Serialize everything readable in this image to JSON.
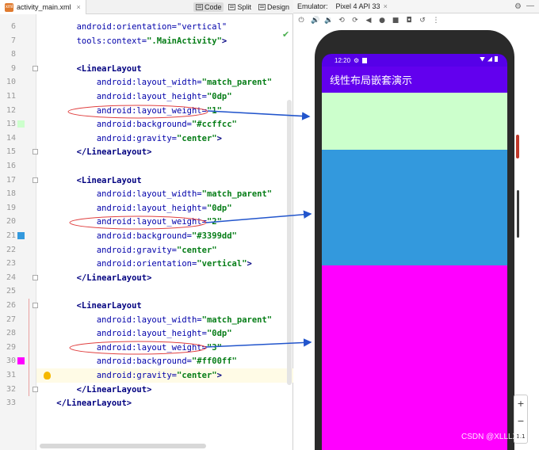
{
  "editor": {
    "file_tab": "activity_main.xml",
    "file_close": "×",
    "xml_badge": "xml",
    "view_modes": [
      "Code",
      "Split",
      "Design"
    ],
    "lines": [
      {
        "num": "6",
        "parts": [
          {
            "t": "attr",
            "v": "        android:orientation=\"vertical\""
          }
        ]
      },
      {
        "num": "7",
        "parts": [
          {
            "t": "attr",
            "v": "        tools:context="
          },
          {
            "t": "val",
            "v": "\".MainActivity\""
          },
          {
            "t": "tag",
            "v": ">"
          }
        ]
      },
      {
        "num": "8",
        "parts": []
      },
      {
        "num": "9",
        "parts": [
          {
            "t": "tag",
            "v": "        <LinearLayout"
          }
        ]
      },
      {
        "num": "10",
        "parts": [
          {
            "t": "attr",
            "v": "            android:layout_width="
          },
          {
            "t": "val",
            "v": "\"match_parent\""
          }
        ]
      },
      {
        "num": "11",
        "parts": [
          {
            "t": "attr",
            "v": "            android:layout_height="
          },
          {
            "t": "val",
            "v": "\"0dp\""
          }
        ]
      },
      {
        "num": "12",
        "parts": [
          {
            "t": "attr",
            "v": "            android:layout_weight="
          },
          {
            "t": "val",
            "v": "\"1\""
          }
        ]
      },
      {
        "num": "13",
        "parts": [
          {
            "t": "attr",
            "v": "            android:background="
          },
          {
            "t": "val",
            "v": "\"#ccffcc\""
          }
        ]
      },
      {
        "num": "14",
        "parts": [
          {
            "t": "attr",
            "v": "            android:gravity="
          },
          {
            "t": "val",
            "v": "\"center\""
          },
          {
            "t": "tag",
            "v": ">"
          }
        ]
      },
      {
        "num": "15",
        "parts": [
          {
            "t": "tag",
            "v": "        </LinearLayout>"
          }
        ]
      },
      {
        "num": "16",
        "parts": []
      },
      {
        "num": "17",
        "parts": [
          {
            "t": "tag",
            "v": "        <LinearLayout"
          }
        ]
      },
      {
        "num": "18",
        "parts": [
          {
            "t": "attr",
            "v": "            android:layout_width="
          },
          {
            "t": "val",
            "v": "\"match_parent\""
          }
        ]
      },
      {
        "num": "19",
        "parts": [
          {
            "t": "attr",
            "v": "            android:layout_height="
          },
          {
            "t": "val",
            "v": "\"0dp\""
          }
        ]
      },
      {
        "num": "20",
        "parts": [
          {
            "t": "attr",
            "v": "            android:layout_weight="
          },
          {
            "t": "val",
            "v": "\"2\""
          }
        ]
      },
      {
        "num": "21",
        "parts": [
          {
            "t": "attr",
            "v": "            android:background="
          },
          {
            "t": "val",
            "v": "\"#3399dd\""
          }
        ]
      },
      {
        "num": "22",
        "parts": [
          {
            "t": "attr",
            "v": "            android:gravity="
          },
          {
            "t": "val",
            "v": "\"center\""
          }
        ]
      },
      {
        "num": "23",
        "parts": [
          {
            "t": "attr",
            "v": "            android:orientation="
          },
          {
            "t": "val",
            "v": "\"vertical\""
          },
          {
            "t": "tag",
            "v": ">"
          }
        ]
      },
      {
        "num": "24",
        "parts": [
          {
            "t": "tag",
            "v": "        </LinearLayout>"
          }
        ]
      },
      {
        "num": "25",
        "parts": []
      },
      {
        "num": "26",
        "parts": [
          {
            "t": "tag",
            "v": "        <LinearLayout"
          }
        ]
      },
      {
        "num": "27",
        "parts": [
          {
            "t": "attr",
            "v": "            android:layout_width="
          },
          {
            "t": "val",
            "v": "\"match_parent\""
          }
        ]
      },
      {
        "num": "28",
        "parts": [
          {
            "t": "attr",
            "v": "            android:layout_height="
          },
          {
            "t": "val",
            "v": "\"0dp\""
          }
        ]
      },
      {
        "num": "29",
        "parts": [
          {
            "t": "attr",
            "v": "            android:layout_weight="
          },
          {
            "t": "val",
            "v": "\"3\""
          }
        ]
      },
      {
        "num": "30",
        "parts": [
          {
            "t": "attr",
            "v": "            android:background="
          },
          {
            "t": "val",
            "v": "\"#ff00ff\""
          }
        ]
      },
      {
        "num": "31",
        "parts": [
          {
            "t": "attr",
            "v": "            android:gravity="
          },
          {
            "t": "val",
            "v": "\"center\""
          },
          {
            "t": "tag",
            "v": ">"
          }
        ]
      },
      {
        "num": "32",
        "parts": [
          {
            "t": "tag",
            "v": "        </LinearLayout>"
          }
        ]
      },
      {
        "num": "33",
        "parts": [
          {
            "t": "tag",
            "v": "    </LinearLayout>"
          }
        ]
      }
    ],
    "swatches": [
      {
        "line": "13",
        "color": "#ccffcc"
      },
      {
        "line": "21",
        "color": "#3399dd"
      },
      {
        "line": "30",
        "color": "#ff00ff"
      }
    ]
  },
  "emulator": {
    "label": "Emulator:",
    "device": "Pixel 4 API 33",
    "device_close": "×",
    "status_time": "12:20",
    "app_title": "线性布局嵌套演示",
    "block_colors": [
      "#ccffcc",
      "#3399dd",
      "#ff00ff"
    ],
    "weights": [
      1,
      2,
      3
    ],
    "zoom_plus": "+",
    "zoom_minus": "−",
    "zoom_fit": "1:1"
  },
  "watermark": "CSDN @XLLLXX"
}
